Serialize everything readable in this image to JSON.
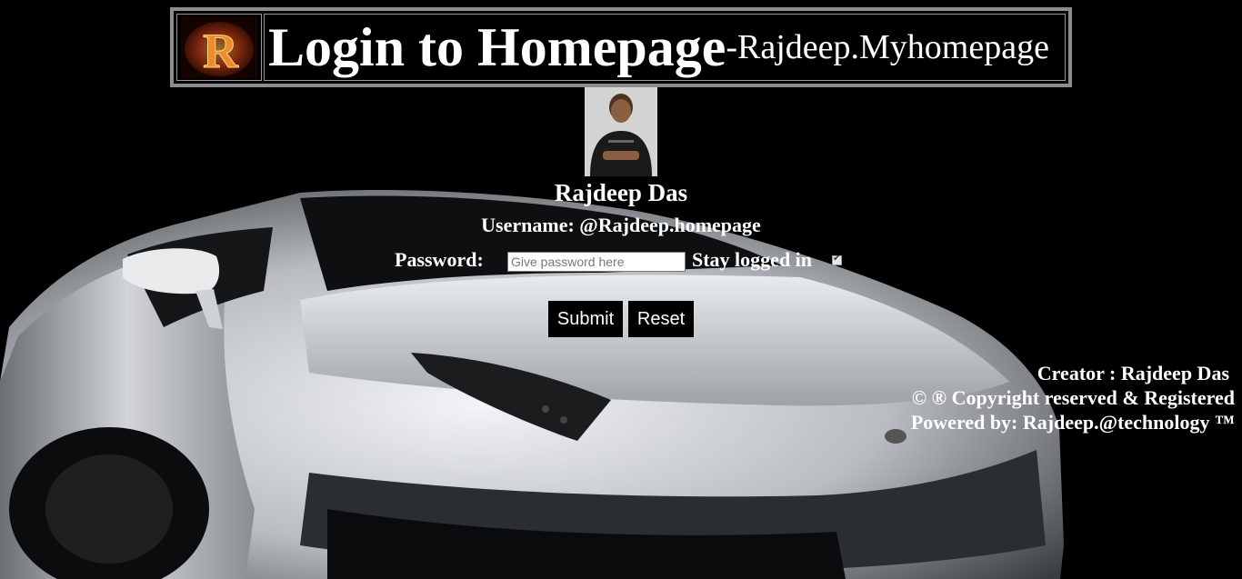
{
  "header": {
    "logo_letter": "R",
    "title_main": "Login to Homepage",
    "title_sub": "-Rajdeep.Myhomepage"
  },
  "profile": {
    "name": "Rajdeep Das",
    "username": "Username: @Rajdeep.homepage"
  },
  "form": {
    "password_label": "Password:",
    "password_placeholder": "Give password here",
    "password_value": "",
    "stay_logged_in_label": "Stay logged in",
    "stay_logged_in_checked": true,
    "submit_label": "Submit",
    "reset_label": "Reset"
  },
  "footer": {
    "creator": "Creator : Rajdeep Das",
    "copyright": "© ® Copyright reserved & Registered",
    "powered": "Powered by: Rajdeep.@technology ™"
  },
  "colors": {
    "background": "#000000",
    "text": "#ffffff",
    "banner_border": "#8d8d8d",
    "car": "#d6d9dc"
  }
}
